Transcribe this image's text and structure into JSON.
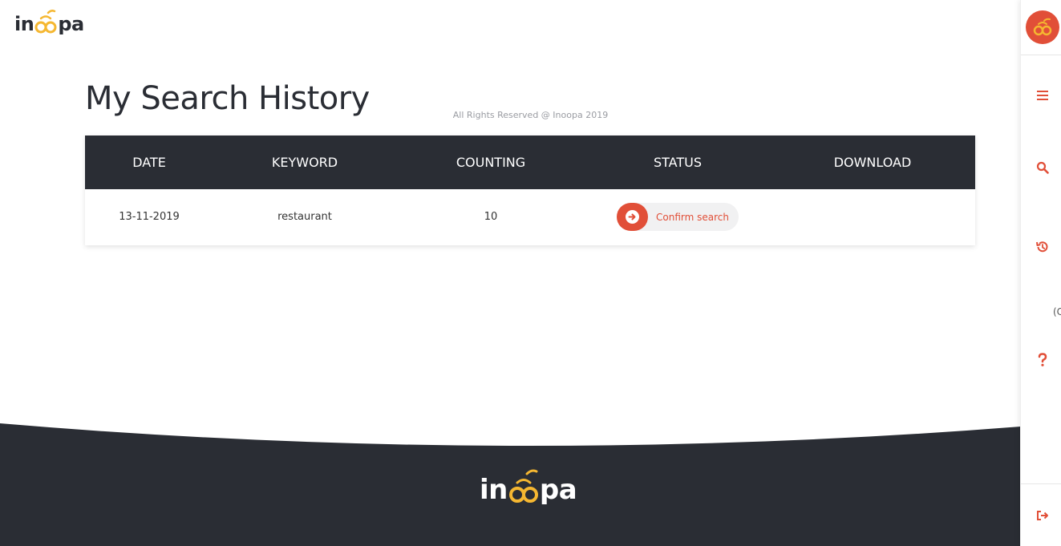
{
  "brand": {
    "name_left": "in",
    "name_right": "pa",
    "accent": "#f5b731",
    "primary": "#e14f38",
    "dark": "#2a2d34"
  },
  "page": {
    "title": "My Search History"
  },
  "table": {
    "headers": [
      "DATE",
      "KEYWORD",
      "COUNTING",
      "STATUS",
      "DOWNLOAD"
    ],
    "rows": [
      {
        "date": "13-11-2019",
        "keyword": "restaurant",
        "counting": "10",
        "status_label": "Confirm search",
        "status_icon": "arrow-circle-right-icon"
      }
    ]
  },
  "footer": {
    "copyright": "All Rights Reserved @ Inoopa 2019"
  },
  "sidebar": {
    "icons": [
      "menu-icon",
      "search-icon",
      "history-icon",
      "help-icon",
      "logout-icon"
    ],
    "partial_text": "(C"
  }
}
